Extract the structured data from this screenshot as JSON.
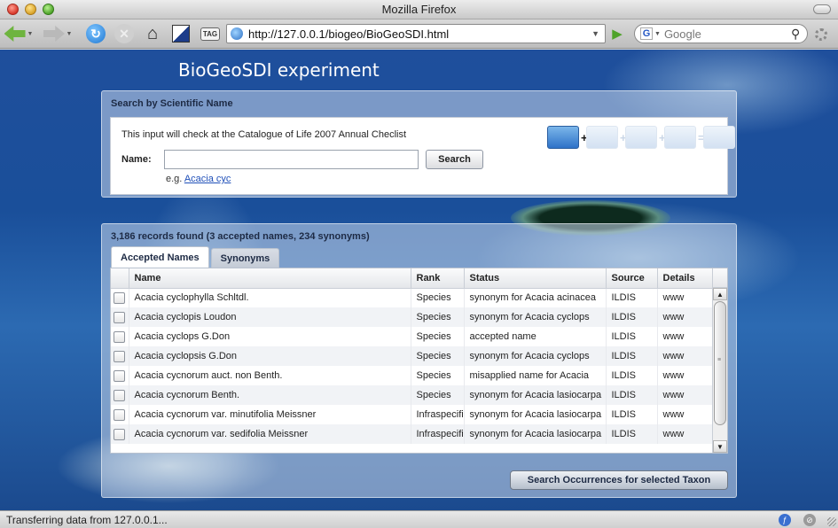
{
  "window": {
    "title": "Mozilla Firefox"
  },
  "toolbar": {
    "url": "http://127.0.0.1/biogeo/BioGeoSDI.html",
    "search_placeholder": "Google",
    "tag_label": "TAG"
  },
  "page": {
    "title": "BioGeoSDI experiment",
    "search_panel": {
      "header": "Search by Scientific Name",
      "info": "This input will check at the Catalogue of Life 2007 Annual Checlist",
      "name_label": "Name:",
      "name_value": "",
      "search_button": "Search",
      "example_prefix": "e.g.",
      "example_link": "Acacia cyc"
    },
    "results_panel": {
      "summary": "3,186 records found (3 accepted names, 234 synonyms)",
      "tabs": [
        {
          "label": "Accepted Names",
          "active": true
        },
        {
          "label": "Synonyms",
          "active": false
        }
      ],
      "columns": [
        "Name",
        "Rank",
        "Status",
        "Source",
        "Details"
      ],
      "rows": [
        {
          "name": "Acacia cyclophylla Schltdl.",
          "rank": "Species",
          "status": "synonym for Acacia acinacea",
          "source": "ILDIS",
          "details": "www"
        },
        {
          "name": "Acacia cyclopis Loudon",
          "rank": "Species",
          "status": "synonym for Acacia cyclops",
          "source": "ILDIS",
          "details": "www"
        },
        {
          "name": "Acacia cyclops G.Don",
          "rank": "Species",
          "status": "accepted name",
          "source": "ILDIS",
          "details": "www"
        },
        {
          "name": "Acacia cyclopsis G.Don",
          "rank": "Species",
          "status": "synonym for Acacia cyclops",
          "source": "ILDIS",
          "details": "www"
        },
        {
          "name": "Acacia cycnorum auct. non Benth.",
          "rank": "Species",
          "status": "misapplied name for Acacia",
          "source": "ILDIS",
          "details": "www"
        },
        {
          "name": "Acacia cycnorum Benth.",
          "rank": "Species",
          "status": "synonym for Acacia lasiocarpa",
          "source": "ILDIS",
          "details": "www"
        },
        {
          "name": "Acacia cycnorum var. minutifolia Meissner",
          "rank": "Infraspecific",
          "status": "synonym for Acacia lasiocarpa",
          "source": "ILDIS",
          "details": "www"
        },
        {
          "name": "Acacia cycnorum var. sedifolia Meissner",
          "rank": "Infraspecific",
          "status": "synonym for Acacia lasiocarpa",
          "source": "ILDIS",
          "details": "www"
        }
      ],
      "occurrences_button": "Search Occurrences for selected Taxon"
    }
  },
  "status": {
    "text": "Transferring data from 127.0.0.1..."
  },
  "colors": {
    "link": "#1f4fb8",
    "accent_green": "#6eb43f",
    "panel_text": "#1d2a44"
  }
}
